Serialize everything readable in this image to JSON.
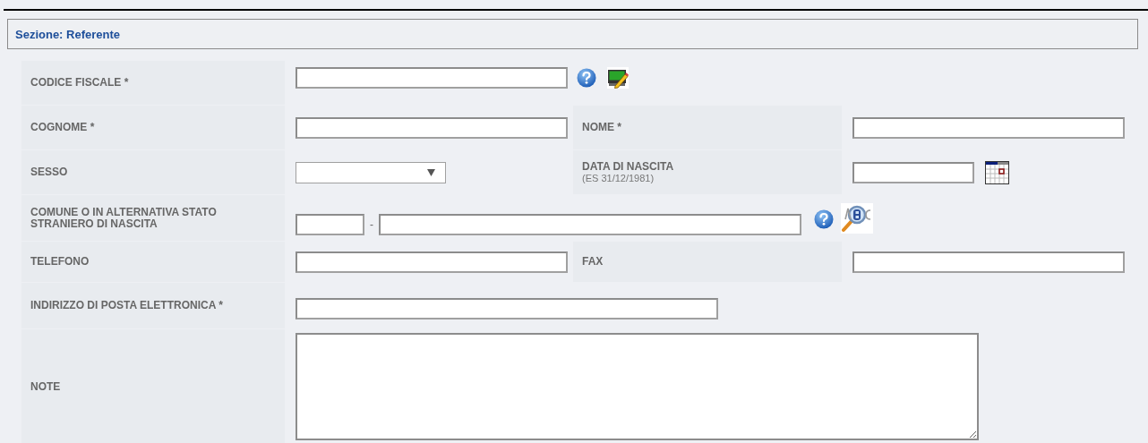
{
  "section": {
    "title": "Sezione: Referente"
  },
  "rows": [
    {
      "cells": [
        {
          "label": "CODICE FISCALE *",
          "controls": [
            {
              "kind": "text"
            },
            {
              "kind": "help"
            },
            {
              "kind": "edit"
            }
          ]
        }
      ]
    },
    {
      "cells": [
        {
          "label": "COGNOME *",
          "controls": [
            {
              "kind": "text"
            }
          ]
        },
        {
          "label": "NOME *",
          "controls": [
            {
              "kind": "text"
            }
          ]
        }
      ]
    },
    {
      "cells": [
        {
          "label": "SESSO",
          "controls": [
            {
              "kind": "select"
            }
          ]
        },
        {
          "label": "DATA DI NASCITA",
          "hint": "(ES 31/12/1981)",
          "controls": [
            {
              "kind": "date"
            },
            {
              "kind": "calendar"
            }
          ]
        }
      ]
    },
    {
      "cells": [
        {
          "label": "COMUNE O IN ALTERNATIVA STATO STRANIERO DI NASCITA",
          "controls": [
            {
              "kind": "code"
            },
            {
              "kind": "separator",
              "text": "-"
            },
            {
              "kind": "wide-text"
            },
            {
              "kind": "help"
            },
            {
              "kind": "lookup"
            }
          ]
        }
      ]
    },
    {
      "cells": [
        {
          "label": "TELEFONO",
          "controls": [
            {
              "kind": "text"
            }
          ]
        },
        {
          "label": "FAX",
          "controls": [
            {
              "kind": "text"
            }
          ]
        }
      ]
    },
    {
      "cells": [
        {
          "label": "INDIRIZZO DI POSTA ELETTRONICA *",
          "controls": [
            {
              "kind": "wide-text"
            }
          ]
        }
      ]
    },
    {
      "cells": [
        {
          "label": "NOTE",
          "controls": [
            {
              "kind": "textarea"
            }
          ]
        }
      ]
    }
  ]
}
